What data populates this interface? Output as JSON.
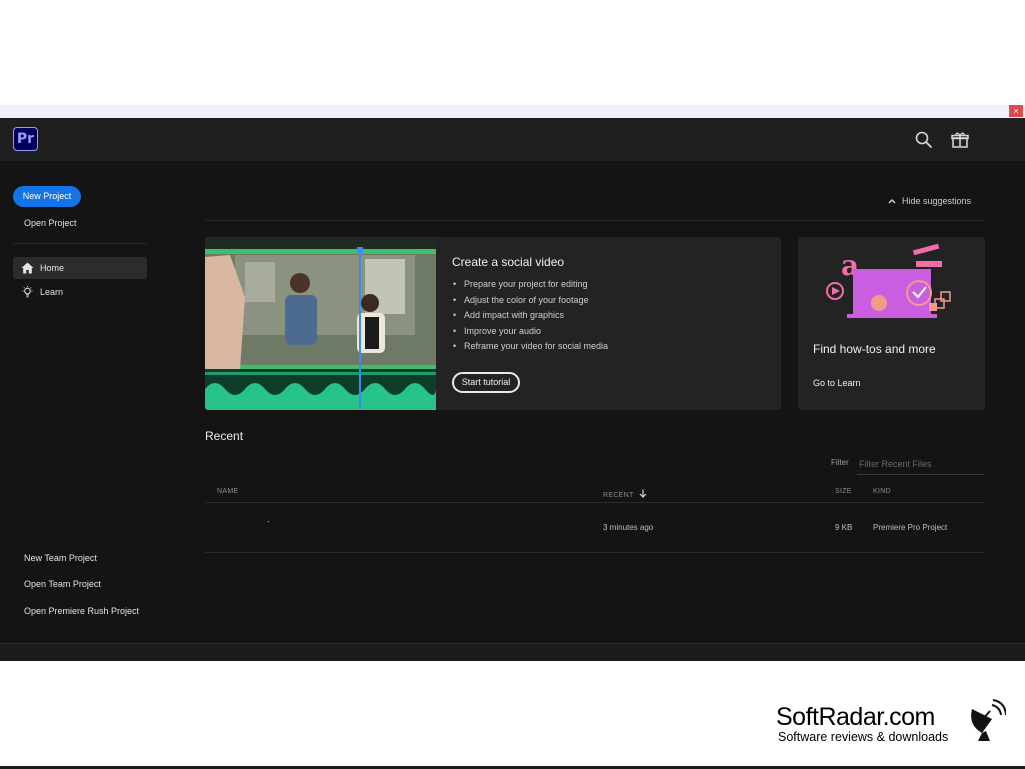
{
  "window": {
    "close_glyph": "×"
  },
  "app": {
    "logo_text": "Pr",
    "accent_color": "#1473e6",
    "logo_color": "#9999ff"
  },
  "titlebar": {
    "icons": [
      "search-icon",
      "gift-icon"
    ]
  },
  "sidebar": {
    "new_project": "New Project",
    "open_project": "Open Project",
    "nav": [
      {
        "label": "Home",
        "icon": "home-icon",
        "active": true
      },
      {
        "label": "Learn",
        "icon": "lightbulb-icon",
        "active": false
      }
    ],
    "bottom_links": [
      "New Team Project",
      "Open Team Project",
      "Open Premiere Rush Project"
    ]
  },
  "suggestions": {
    "hide_label": "Hide suggestions",
    "social_card": {
      "title": "Create a social video",
      "bullets": [
        "Prepare your project for editing",
        "Adjust the color of your footage",
        "Add impact with graphics",
        "Improve your audio",
        "Reframe your video for social media"
      ],
      "button": "Start tutorial"
    },
    "learn_card": {
      "title": "Find how-tos and more",
      "link": "Go to Learn"
    }
  },
  "recent": {
    "title": "Recent",
    "filter_label": "Filter",
    "filter_placeholder": "Filter Recent Files",
    "columns": {
      "name": "NAME",
      "recent": "RECENT",
      "size": "SIZE",
      "kind": "KIND"
    },
    "files": [
      {
        "name": "-",
        "recent": "3 minutes ago",
        "size": "9 KB",
        "kind": "Premiere Pro Project"
      }
    ]
  },
  "watermark": {
    "title": "SoftRadar.com",
    "subtitle": "Software reviews & downloads"
  }
}
